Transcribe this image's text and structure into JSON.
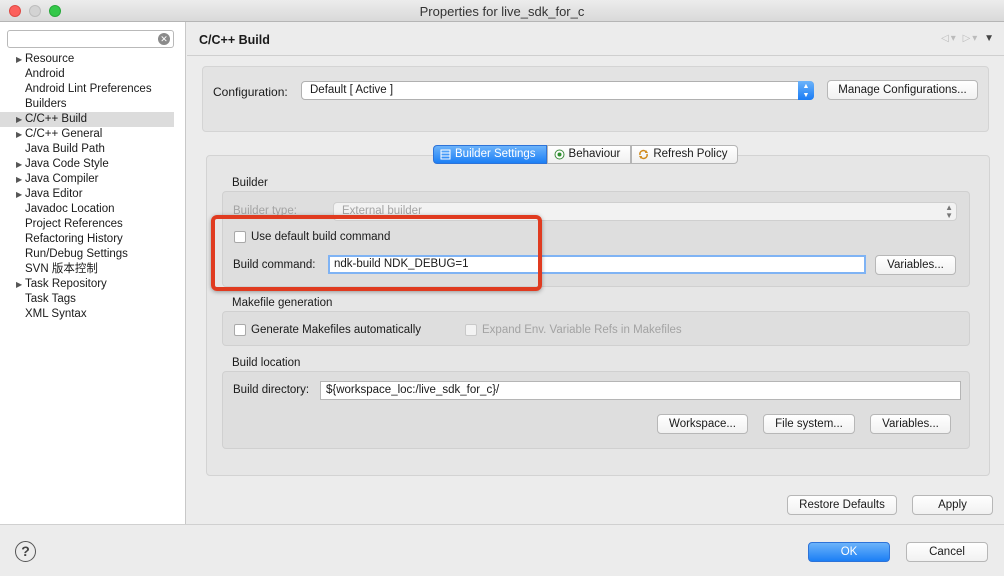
{
  "window": {
    "title": "Properties for live_sdk_for_c"
  },
  "sidebar": {
    "filter_value": "",
    "items": [
      {
        "label": "Resource",
        "expandable": true
      },
      {
        "label": "Android",
        "expandable": false
      },
      {
        "label": "Android Lint Preferences",
        "expandable": false
      },
      {
        "label": "Builders",
        "expandable": false
      },
      {
        "label": "C/C++ Build",
        "expandable": true,
        "selected": true
      },
      {
        "label": "C/C++ General",
        "expandable": true
      },
      {
        "label": "Java Build Path",
        "expandable": false
      },
      {
        "label": "Java Code Style",
        "expandable": true
      },
      {
        "label": "Java Compiler",
        "expandable": true
      },
      {
        "label": "Java Editor",
        "expandable": true
      },
      {
        "label": "Javadoc Location",
        "expandable": false
      },
      {
        "label": "Project References",
        "expandable": false
      },
      {
        "label": "Refactoring History",
        "expandable": false
      },
      {
        "label": "Run/Debug Settings",
        "expandable": false
      },
      {
        "label": "SVN 版本控制",
        "expandable": false
      },
      {
        "label": "Task Repository",
        "expandable": true
      },
      {
        "label": "Task Tags",
        "expandable": false
      },
      {
        "label": "XML Syntax",
        "expandable": false
      }
    ]
  },
  "page": {
    "title": "C/C++ Build",
    "configuration": {
      "label": "Configuration:",
      "value": "Default  [ Active ]",
      "manage_button": "Manage Configurations..."
    },
    "tabs": [
      {
        "label": "Builder Settings",
        "icon": "builder-settings-icon",
        "active": true
      },
      {
        "label": "Behaviour",
        "icon": "behaviour-icon",
        "active": false
      },
      {
        "label": "Refresh Policy",
        "icon": "refresh-policy-icon",
        "active": false
      }
    ],
    "builder": {
      "group_label": "Builder",
      "type_label": "Builder type:",
      "type_value": "External builder",
      "use_default_label": "Use default build command",
      "use_default_checked": false,
      "command_label": "Build command:",
      "command_value": "ndk-build NDK_DEBUG=1",
      "variables_button": "Variables..."
    },
    "makefile": {
      "group_label": "Makefile generation",
      "generate_label": "Generate Makefiles automatically",
      "generate_checked": false,
      "expand_label": "Expand Env. Variable Refs in Makefiles",
      "expand_checked": false
    },
    "location": {
      "group_label": "Build location",
      "directory_label": "Build directory:",
      "directory_value": "${workspace_loc:/live_sdk_for_c}/",
      "workspace_button": "Workspace...",
      "filesystem_button": "File system...",
      "variables_button": "Variables..."
    },
    "restore_defaults_button": "Restore Defaults",
    "apply_button": "Apply"
  },
  "footer": {
    "ok_button": "OK",
    "cancel_button": "Cancel"
  },
  "colors": {
    "accent": "#1c7ff5",
    "highlight": "#e03b20"
  }
}
